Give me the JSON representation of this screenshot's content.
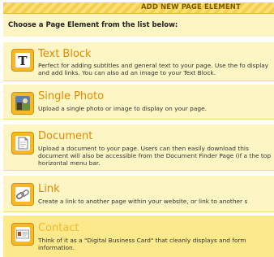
{
  "header": {
    "title": "ADD NEW PAGE ELEMENT"
  },
  "intro": {
    "text": "Choose a Page Element from the list below:"
  },
  "items": [
    {
      "title": "Text Block",
      "icon": "text-block-icon",
      "desc": "Perfect for adding subtitles and general text to your page. Use the fo display and add links. You can also ad an image to your Text Block."
    },
    {
      "title": "Single Photo",
      "icon": "photo-icon",
      "desc": "Upload a single photo or image to display on your page."
    },
    {
      "title": "Document",
      "icon": "document-icon",
      "desc": "Upload a document to your page. Users can then easily download this document will also be accessible from the Document Finder Page (if a the top horizontal menu bar."
    },
    {
      "title": "Link",
      "icon": "link-icon",
      "desc": "Create a link to another page within your website, or link to another s"
    },
    {
      "title": "Contact",
      "icon": "contact-card-icon",
      "desc": "Think of it as a \"Digital Business Card\" that cleanly displays and form information."
    }
  ],
  "colors": {
    "accent": "#e38a00",
    "row_bg": "#fdf5c4",
    "highlight_bg": "#fbe98c",
    "header_stripe": "#f4cf4e"
  }
}
